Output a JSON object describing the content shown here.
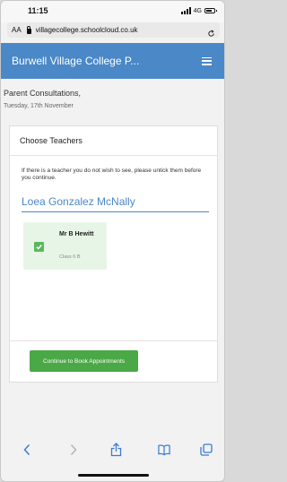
{
  "status_bar": {
    "time": "11:15",
    "network": "4G",
    "battery_level": 0.7
  },
  "address_bar": {
    "aa_label": "AA",
    "url": "villagecollege.schoolcloud.co.uk",
    "lock_icon": "lock-icon",
    "reload_icon": "reload-icon"
  },
  "header": {
    "title": "Burwell Village College P...",
    "menu_icon": "hamburger-menu-icon",
    "background_color": "#4a88c7"
  },
  "page": {
    "title": "Parent Consultations,",
    "date": "Tuesday, 17th November"
  },
  "card": {
    "title": "Choose Teachers",
    "intro": "If there is a teacher you do not wish to see, please untick them before you continue.",
    "child_name": "Loea Gonzalez McNally",
    "teachers": [
      {
        "name": "Mr B Hewitt",
        "class": "Class 6 B",
        "selected": true
      }
    ],
    "continue_label": "Continue to Book Appointments",
    "accent_color": "#4aa846"
  },
  "toolbar": {
    "back_icon": "back-chevron-icon",
    "forward_icon": "forward-chevron-icon",
    "share_icon": "share-icon",
    "bookmarks_icon": "bookmarks-icon",
    "tabs_icon": "tabs-icon"
  }
}
